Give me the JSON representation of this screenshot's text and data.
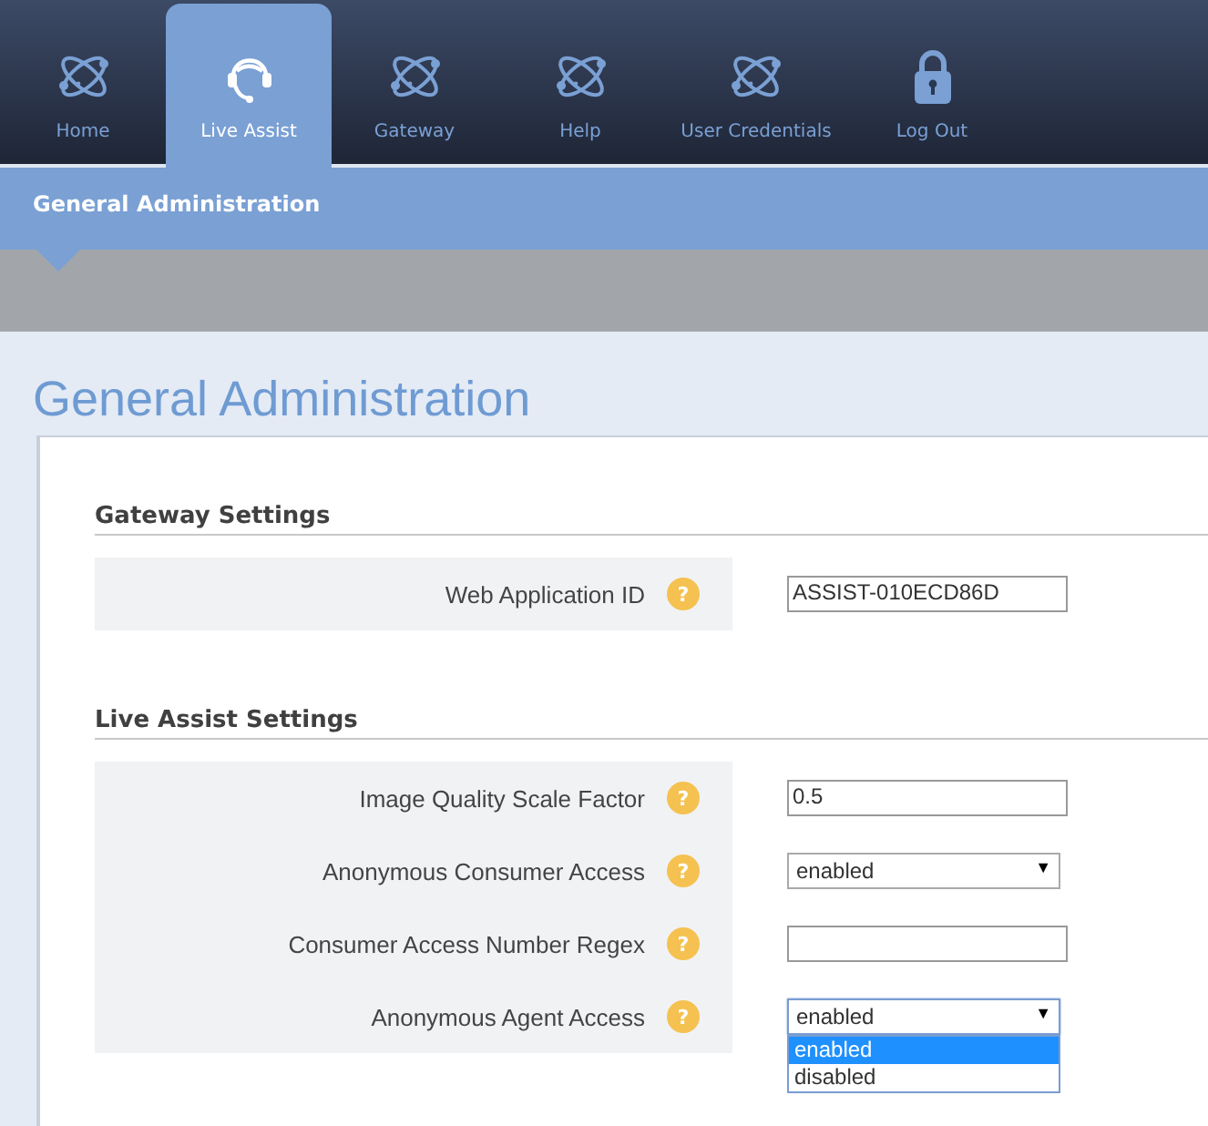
{
  "nav": [
    {
      "label": "Home",
      "kind": "atom",
      "selected": false
    },
    {
      "label": "Live Assist",
      "kind": "headset",
      "selected": true
    },
    {
      "label": "Gateway",
      "kind": "atom",
      "selected": false
    },
    {
      "label": "Help",
      "kind": "atom",
      "selected": false
    },
    {
      "label": "User Credentials",
      "kind": "atom",
      "selected": false
    },
    {
      "label": "Log Out",
      "kind": "lock",
      "selected": false
    }
  ],
  "breadcrumb": "General Administration",
  "title": "General Administration",
  "sections": [
    {
      "heading": "Gateway Settings",
      "rows": [
        {
          "label": "Web Application ID",
          "help": "?",
          "kind": "text",
          "value": "ASSIST-010ECD86D"
        }
      ]
    },
    {
      "heading": "Live Assist Settings",
      "rows": [
        {
          "label": "Image Quality Scale Factor",
          "help": "?",
          "kind": "text",
          "value": "0.5"
        },
        {
          "label": "Anonymous Consumer Access",
          "help": "?",
          "kind": "select",
          "value": "enabled",
          "arrow": "▼",
          "expanded": false
        },
        {
          "label": "Consumer Access Number Regex",
          "help": "?",
          "kind": "text"
        },
        {
          "label": "Anonymous Agent Access",
          "help": "?",
          "kind": "select",
          "value": "enabled",
          "arrow": "▼",
          "expanded": true,
          "options": [
            {
              "label": "enabled",
              "selected": true
            },
            {
              "label": "disabled",
              "selected": false
            }
          ]
        }
      ]
    }
  ]
}
